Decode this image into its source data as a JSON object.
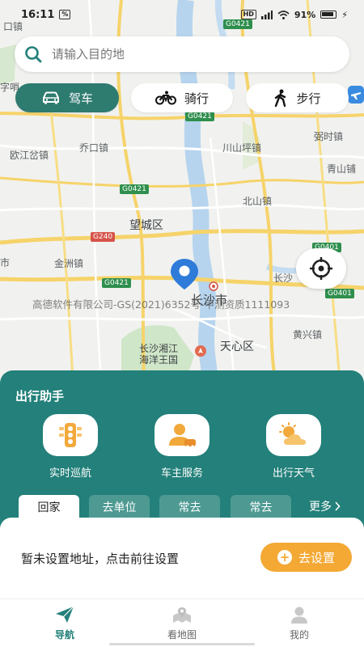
{
  "status_bar": {
    "time": "16:11",
    "network": "HD",
    "battery": "91%"
  },
  "search": {
    "placeholder": "请输入目的地"
  },
  "modes": [
    {
      "label": "驾车",
      "icon": "car-icon",
      "active": true
    },
    {
      "label": "骑行",
      "icon": "bicycle-icon",
      "active": false
    },
    {
      "label": "步行",
      "icon": "walk-icon",
      "active": false
    }
  ],
  "map": {
    "places": [
      "欧江岔镇",
      "乔口镇",
      "川山坪镇",
      "北山镇",
      "望城区",
      "金洲镇",
      "长沙市",
      "天心区",
      "黄兴镇",
      "弼时镇",
      "青山铺",
      "长沙"
    ],
    "poi": {
      "line1": "长沙湘江",
      "line2": "海洋王国"
    },
    "edge_labels": [
      "口镇",
      "字哨",
      "市"
    ],
    "road_shields": [
      "G0421",
      "G0421",
      "G0421",
      "G0421",
      "G240",
      "G0401",
      "G0401"
    ],
    "watermark": "高德软件有限公司-GS(2021)6352号-甲测资质1111093"
  },
  "assistant": {
    "title": "出行助手",
    "features": [
      {
        "label": "实时巡航",
        "icon": "traffic-light-icon"
      },
      {
        "label": "车主服务",
        "icon": "car-owner-icon"
      },
      {
        "label": "出行天气",
        "icon": "weather-icon"
      }
    ],
    "tabs": [
      "回家",
      "去单位",
      "常去",
      "常去"
    ],
    "more": "更多"
  },
  "address": {
    "message": "暂未设置地址，点击前往设置",
    "button": "去设置"
  },
  "nav": [
    {
      "label": "导航",
      "icon": "navigate-icon",
      "active": true
    },
    {
      "label": "看地图",
      "icon": "map-icon",
      "active": false
    },
    {
      "label": "我的",
      "icon": "profile-icon",
      "active": false
    }
  ],
  "colors": {
    "primary": "#23807a",
    "accent": "#f4a935",
    "pin": "#2f7bd9"
  }
}
